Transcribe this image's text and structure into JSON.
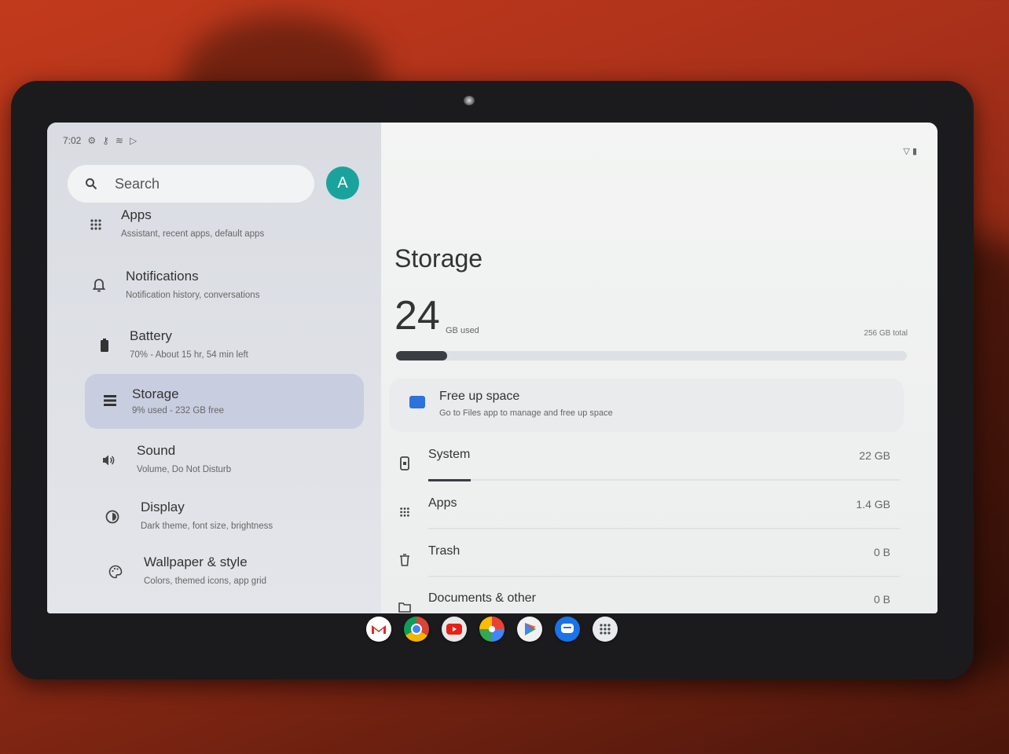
{
  "status_bar": {
    "time": "7:02"
  },
  "search": {
    "placeholder": "Search"
  },
  "account": {
    "initial": "A"
  },
  "sidebar": {
    "items": [
      {
        "title": "Apps",
        "subtitle": "Assistant, recent apps, default apps",
        "icon": "grid-icon"
      },
      {
        "title": "Notifications",
        "subtitle": "Notification history, conversations",
        "icon": "bell-icon"
      },
      {
        "title": "Battery",
        "subtitle": "70% - About 15 hr, 54 min left",
        "icon": "battery-icon"
      },
      {
        "title": "Storage",
        "subtitle": "9% used - 232 GB free",
        "icon": "storage-icon"
      },
      {
        "title": "Sound",
        "subtitle": "Volume, Do Not Disturb",
        "icon": "speaker-icon"
      },
      {
        "title": "Display",
        "subtitle": "Dark theme, font size, brightness",
        "icon": "brightness-icon"
      },
      {
        "title": "Wallpaper & style",
        "subtitle": "Colors, themed icons, app grid",
        "icon": "palette-icon"
      }
    ]
  },
  "storage": {
    "title": "Storage",
    "used_value": "24",
    "used_unit": "GB used",
    "total": "256 GB total",
    "used_fraction": 0.09,
    "free_up": {
      "title": "Free up space",
      "subtitle": "Go to Files app to manage and free up space"
    },
    "categories": [
      {
        "label": "System",
        "value": "22 GB",
        "icon": "phone-icon"
      },
      {
        "label": "Apps",
        "value": "1.4 GB",
        "icon": "grid-icon"
      },
      {
        "label": "Trash",
        "value": "0 B",
        "icon": "trash-icon"
      },
      {
        "label": "Documents & other",
        "value": "0 B",
        "icon": "folder-icon"
      }
    ]
  },
  "dock": {
    "apps": [
      "gmail-icon",
      "chrome-icon",
      "youtube-icon",
      "photos-icon",
      "play-store-icon",
      "messages-icon",
      "app-drawer-icon"
    ]
  },
  "colors": {
    "accent": "#1aa39d",
    "selected_bg": "#c9cde0",
    "progress": "#3a3d44"
  }
}
